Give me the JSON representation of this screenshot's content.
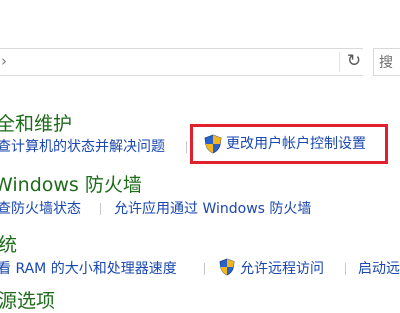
{
  "address_bar": {
    "chevron": "›",
    "refresh_icon": "↻"
  },
  "search": {
    "placeholder": "搜"
  },
  "sections": {
    "security": {
      "heading": "全和维护",
      "links": [
        "查计算机的状态并解决问题",
        "更改用户帐户控制设置"
      ]
    },
    "firewall": {
      "heading": "Windows 防火墙",
      "links": [
        "查防火墙状态",
        "允许应用通过 Windows 防火墙"
      ]
    },
    "system": {
      "heading": "统",
      "links": [
        "看 RAM 的大小和处理器速度",
        "允许远程访问",
        "启动远"
      ]
    },
    "power": {
      "heading": "源选项"
    }
  },
  "icons": {
    "uac_shield": "shield-icon"
  },
  "colors": {
    "heading": "#1e6b1a",
    "link": "#1a47b0",
    "highlight": "#e0202c"
  }
}
